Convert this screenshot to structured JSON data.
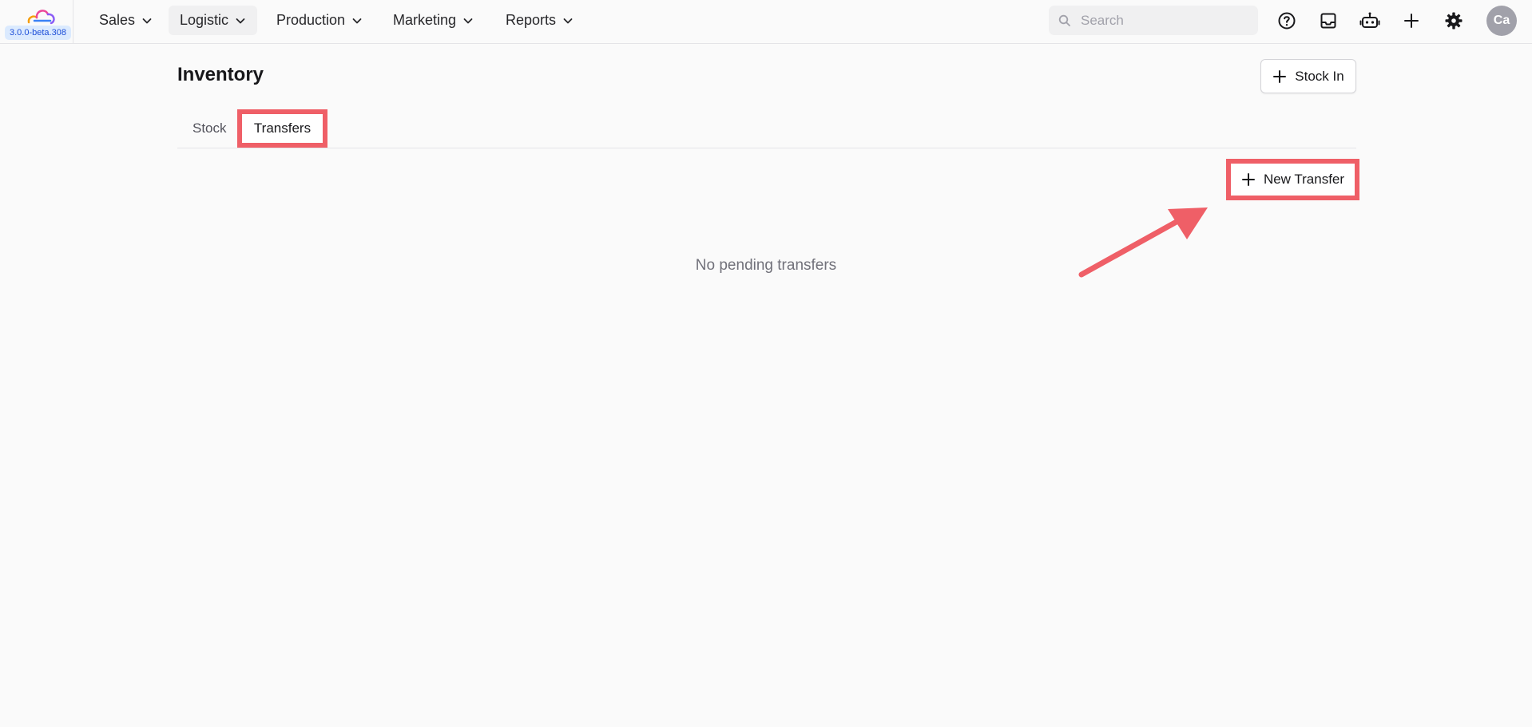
{
  "app": {
    "version": "3.0.0-beta.308"
  },
  "nav": {
    "items": [
      {
        "label": "Sales"
      },
      {
        "label": "Logistic"
      },
      {
        "label": "Production"
      },
      {
        "label": "Marketing"
      },
      {
        "label": "Reports"
      }
    ],
    "active": "Logistic"
  },
  "search": {
    "placeholder": "Search",
    "value": ""
  },
  "toolbar_icons": [
    "help-circle-icon",
    "inbox-icon",
    "bot-icon",
    "plus-icon",
    "gear-icon"
  ],
  "user": {
    "initials": "Ca"
  },
  "page": {
    "title": "Inventory",
    "stock_in_label": "Stock In",
    "tabs": [
      {
        "label": "Stock"
      },
      {
        "label": "Transfers"
      }
    ],
    "active_tab": "Transfers",
    "new_transfer_label": "New Transfer",
    "empty_message": "No pending transfers"
  },
  "colors": {
    "annotation": "#ef5f67",
    "badge_bg": "#dbeafe",
    "badge_text": "#1d4ed8"
  }
}
